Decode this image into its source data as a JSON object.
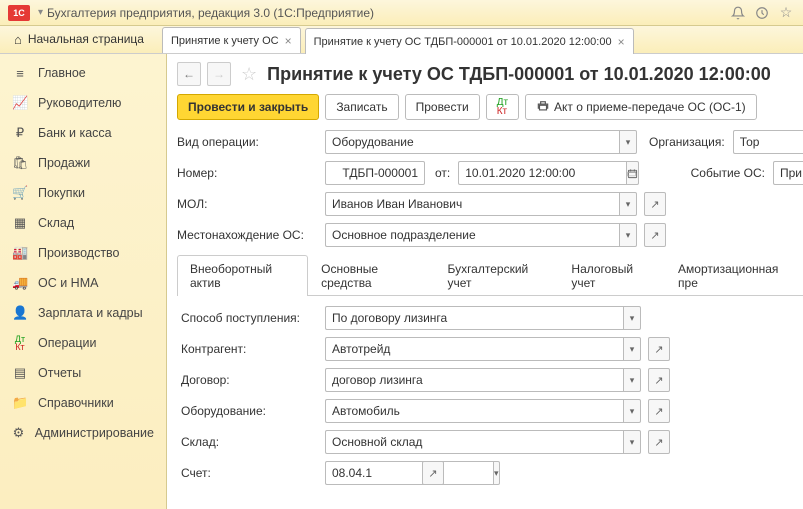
{
  "titlebar": {
    "app": "Бухгалтерия предприятия, редакция 3.0  (1С:Предприятие)"
  },
  "tabs": {
    "home": "Начальная страница",
    "t1": "Принятие к учету ОС",
    "t2": "Принятие к учету ОС ТДБП-000001 от 10.01.2020 12:00:00"
  },
  "sidebar": [
    {
      "icon": "≡",
      "label": "Главное"
    },
    {
      "icon": "📈",
      "label": "Руководителю"
    },
    {
      "icon": "₽",
      "label": "Банк и касса"
    },
    {
      "icon": "🛍",
      "label": "Продажи"
    },
    {
      "icon": "🛒",
      "label": "Покупки"
    },
    {
      "icon": "▦",
      "label": "Склад"
    },
    {
      "icon": "🏭",
      "label": "Производство"
    },
    {
      "icon": "🚚",
      "label": "ОС и НМА"
    },
    {
      "icon": "👤",
      "label": "Зарплата и кадры"
    },
    {
      "icon": "ДтКт",
      "label": "Операции"
    },
    {
      "icon": "▤",
      "label": "Отчеты"
    },
    {
      "icon": "📁",
      "label": "Справочники"
    },
    {
      "icon": "⚙",
      "label": "Администрирование"
    }
  ],
  "page": {
    "title": "Принятие к учету ОС ТДБП-000001 от 10.01.2020 12:00:00",
    "btn_post_close": "Провести и закрыть",
    "btn_write": "Записать",
    "btn_post": "Провести",
    "btn_print": "Акт о приеме-передаче ОС (ОС-1)"
  },
  "form": {
    "op_label": "Вид операции:",
    "op_value": "Оборудование",
    "org_label": "Организация:",
    "org_value": "Тор",
    "num_label": "Номер:",
    "num_value": "ТДБП-000001",
    "date_label": "от:",
    "date_value": "10.01.2020 12:00:00",
    "event_label": "Событие ОС:",
    "event_value": "При",
    "mol_label": "МОЛ:",
    "mol_value": "Иванов Иван Иванович",
    "loc_label": "Местонахождение ОС:",
    "loc_value": "Основное подразделение"
  },
  "subtabs": {
    "t1": "Внеоборотный актив",
    "t2": "Основные средства",
    "t3": "Бухгалтерский учет",
    "t4": "Налоговый учет",
    "t5": "Амортизационная пре"
  },
  "sub": {
    "method_label": "Способ поступления:",
    "method_value": "По договору лизинга",
    "contr_label": "Контрагент:",
    "contr_value": "Автотрейд",
    "dogovor_label": "Договор:",
    "dogovor_value": "договор лизинга",
    "equip_label": "Оборудование:",
    "equip_value": "Автомобиль",
    "sklad_label": "Склад:",
    "sklad_value": "Основной склад",
    "acc_label": "Счет:",
    "acc_value": "08.04.1"
  }
}
